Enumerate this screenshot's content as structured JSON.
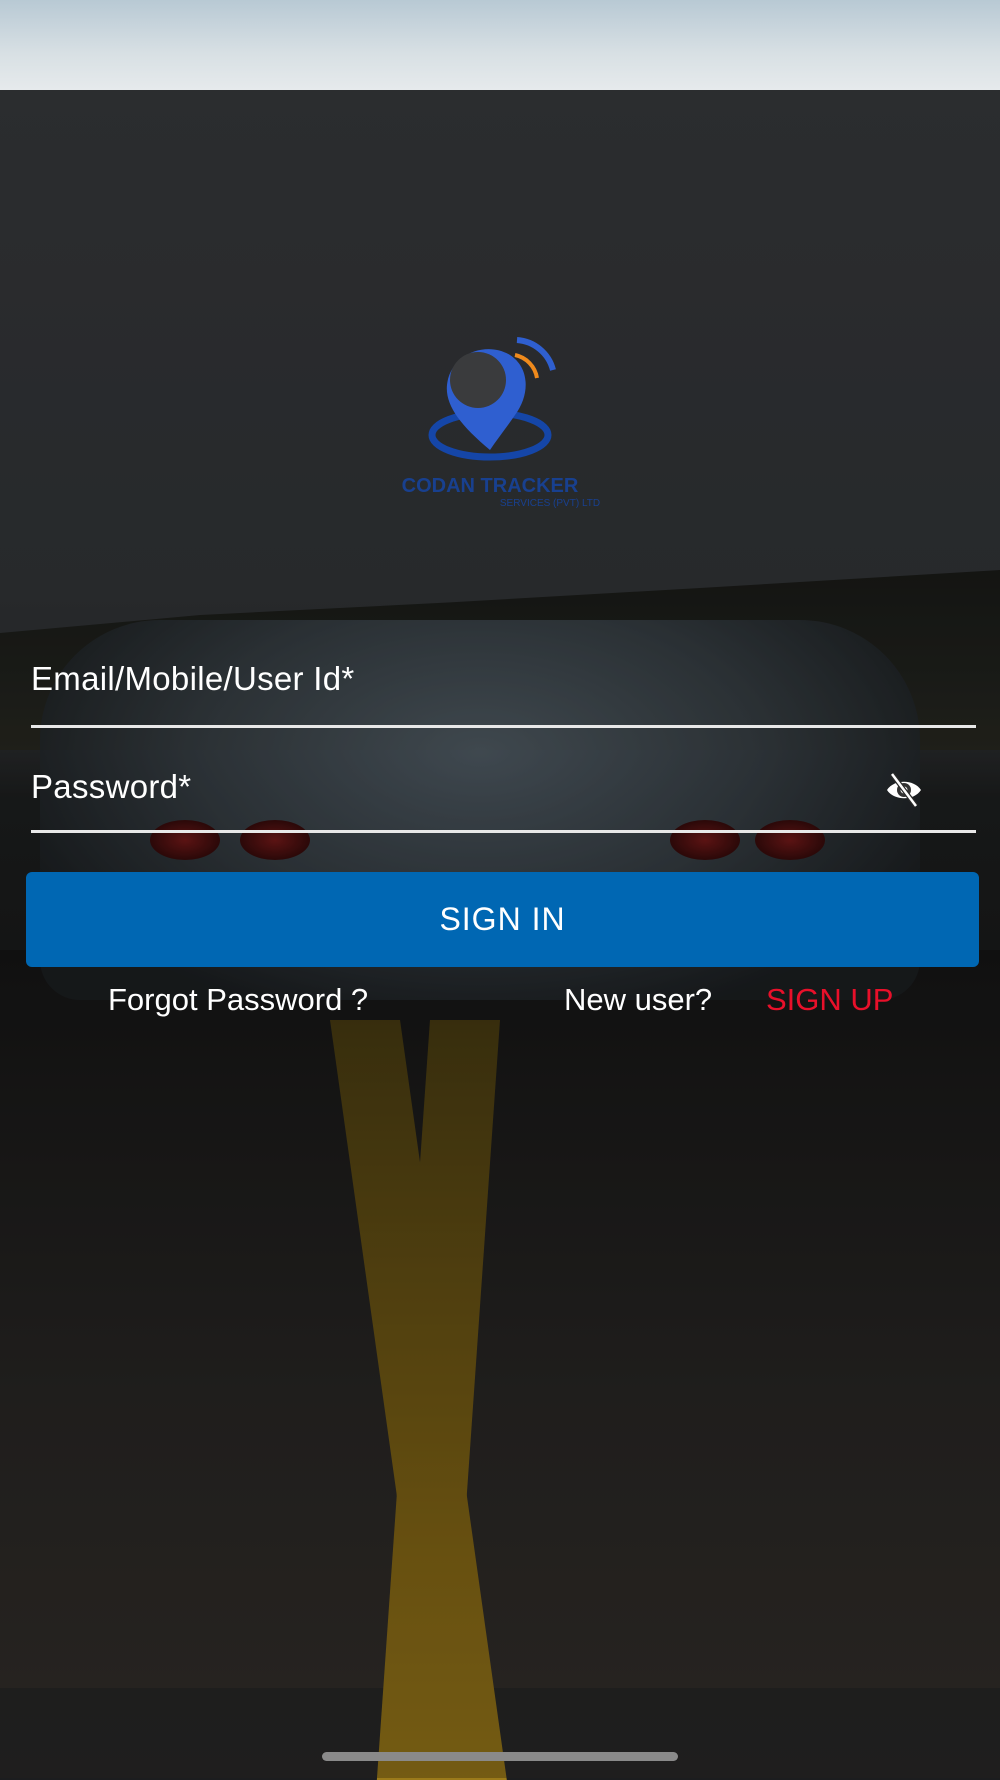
{
  "login": {
    "email_placeholder": "Email/Mobile/User Id*",
    "password_placeholder": "Password*",
    "signin_label": "SIGN IN",
    "forgot_label": "Forgot Password ?",
    "new_user_label": "New user?",
    "signup_label": "SIGN UP"
  },
  "logo": {
    "company_name": "CODAN TRACKER",
    "company_subtitle": "SERVICES (PVT) LTD"
  },
  "icons": {
    "password_toggle": "eye-off-icon"
  },
  "colors": {
    "primary": "#0067b3",
    "signup": "#e8102a",
    "text": "#ffffff"
  }
}
